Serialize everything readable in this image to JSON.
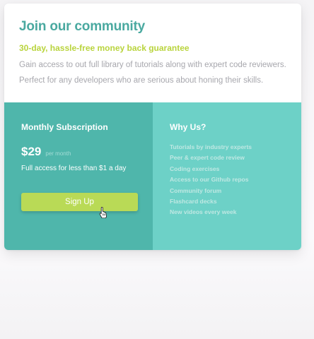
{
  "header": {
    "title": "Join our community",
    "guarantee": "30-day, hassle-free money back guarantee",
    "description": "Gain access to out full library of tutorials along with expert code reviewers. Perfect for any developers who are serious about honing their skills."
  },
  "subscription": {
    "title": "Monthly Subscription",
    "price": "$29",
    "per": "per month",
    "note": "Full access for less than $1 a day",
    "button_label": "Sign Up"
  },
  "why_us": {
    "title": "Why Us?",
    "items": [
      "Tutorials by industry experts",
      "Peer & expert code review",
      "Coding exercises",
      "Access to our Github repos",
      "Community forum",
      "Flashcard decks",
      "New videos every week"
    ]
  },
  "colors": {
    "title": "#4aa9a0",
    "accent_lime": "#b9d43d",
    "left_panel": "#4fb6ab",
    "right_panel": "#6dd1c7",
    "button": "#b9da56"
  },
  "icons": {
    "cursor": "hand-pointer-icon"
  }
}
